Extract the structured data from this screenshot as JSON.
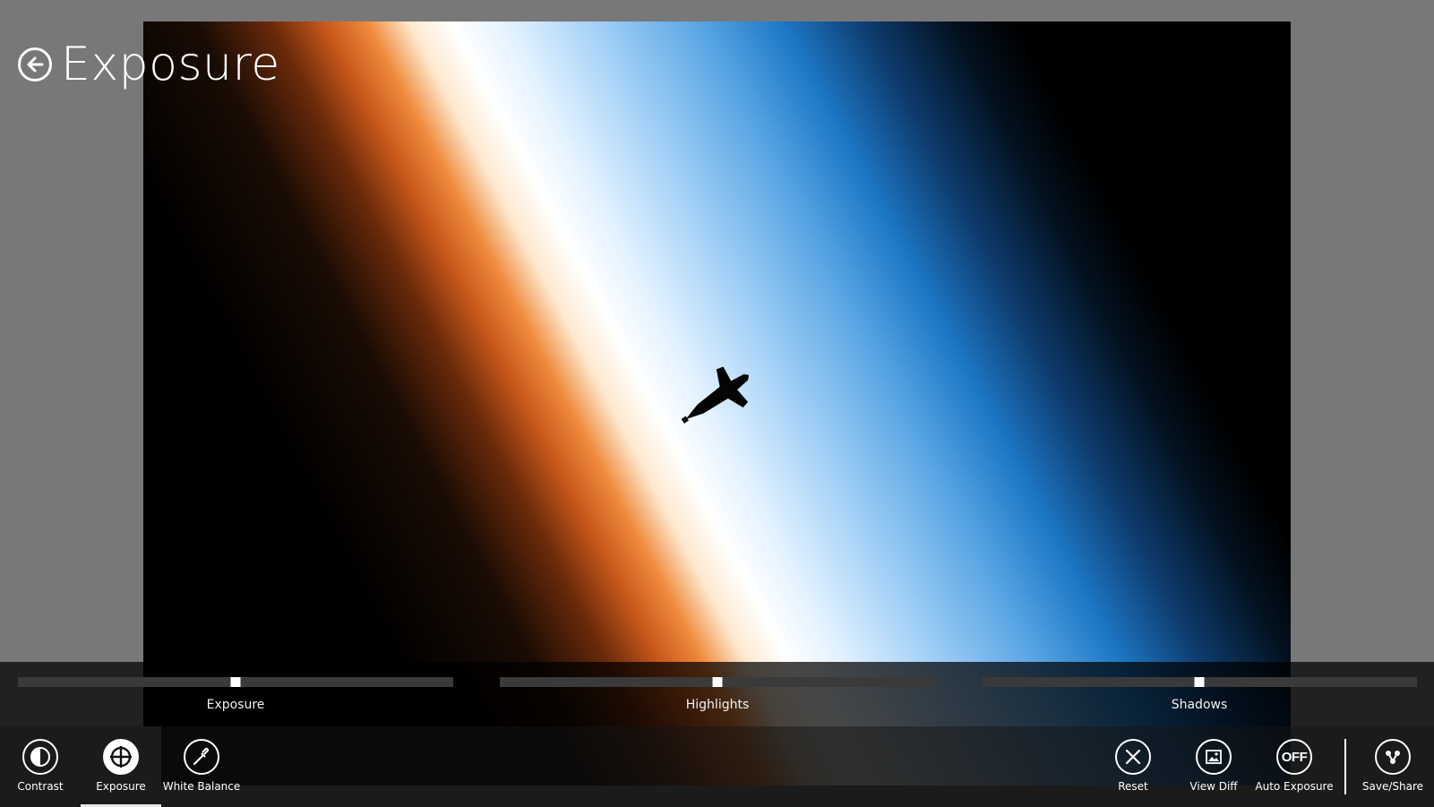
{
  "page": {
    "title": "Exposure"
  },
  "sliders": [
    {
      "label": "Exposure",
      "value": 0.5
    },
    {
      "label": "Highlights",
      "value": 0.5
    },
    {
      "label": "Shadows",
      "value": 0.5
    }
  ],
  "appbar": {
    "left": [
      {
        "label": "Contrast",
        "icon": "contrast-icon",
        "selected": false
      },
      {
        "label": "Exposure",
        "icon": "exposure-icon",
        "selected": true
      },
      {
        "label": "White Balance",
        "icon": "eyedropper-icon",
        "selected": false
      }
    ],
    "right": [
      {
        "label": "Reset",
        "icon": "close-icon"
      },
      {
        "label": "View Diff",
        "icon": "image-icon"
      },
      {
        "label": "Auto Exposure",
        "icon": "off-toggle-icon",
        "toggle_text": "OFF"
      },
      {
        "label": "Save/Share",
        "icon": "share-icon"
      }
    ]
  },
  "colors": {
    "background": "#787878",
    "panel": "#000000",
    "accent": "#ffffff",
    "track": "#3a3a3a"
  }
}
